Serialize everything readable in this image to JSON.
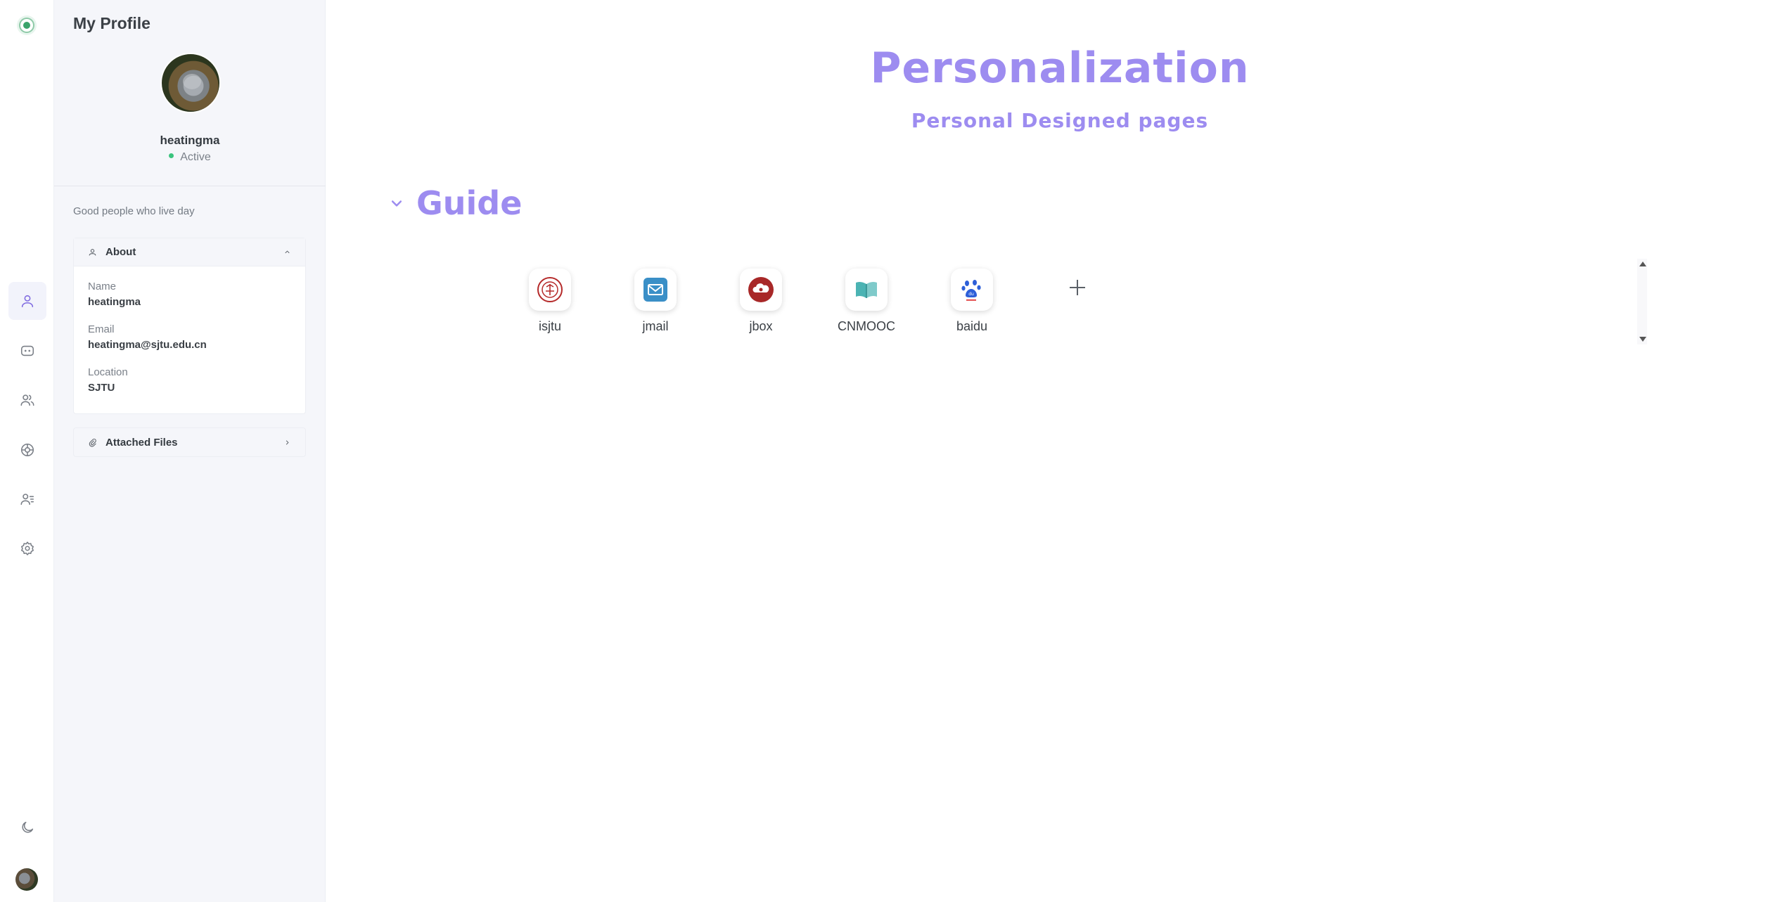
{
  "profile": {
    "title": "My Profile",
    "username": "heatingma",
    "status": "Active",
    "bio": "Good people who live day",
    "about": {
      "header": "About",
      "fields": [
        {
          "label": "Name",
          "value": "heatingma"
        },
        {
          "label": "Email",
          "value": "heatingma@sjtu.edu.cn"
        },
        {
          "label": "Location",
          "value": "SJTU"
        }
      ]
    },
    "files_header": "Attached Files"
  },
  "main": {
    "title": "Personalization",
    "subtitle": "Personal Designed pages",
    "section": "Guide",
    "apps": [
      {
        "name": "isjtu",
        "icon": "sjtu-logo-icon",
        "color": "#b52a2a"
      },
      {
        "name": "jmail",
        "icon": "mail-icon",
        "color": "#3a8fc7"
      },
      {
        "name": "jbox",
        "icon": "cloud-box-icon",
        "color": "#a82828"
      },
      {
        "name": "CNMOOC",
        "icon": "book-icon",
        "color": "#4bb3b3"
      },
      {
        "name": "baidu",
        "icon": "baidu-paw-icon",
        "color": "#2d5fd8"
      }
    ]
  },
  "colors": {
    "accent": "#9d8cf0",
    "status_active": "#3ac47d"
  }
}
